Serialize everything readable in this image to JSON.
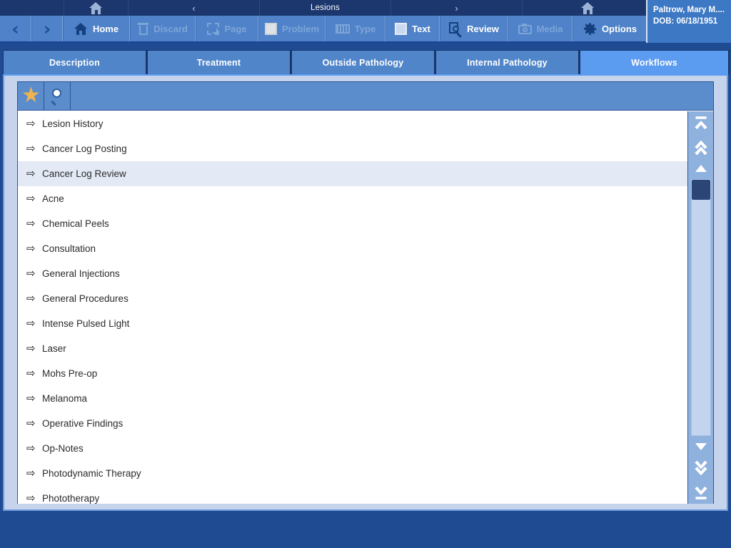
{
  "breadcrumb": {
    "home_icon": "home-icon",
    "prev_label": "‹",
    "title": "Lesions",
    "next_label": "›",
    "home_icon_2": "home-icon"
  },
  "toolbar": {
    "back_label": "‹",
    "forward_label": "›",
    "buttons": [
      {
        "label": "Home",
        "icon": "home-icon",
        "enabled": true
      },
      {
        "label": "Discard",
        "icon": "trash-icon",
        "enabled": false
      },
      {
        "label": "Page",
        "icon": "page-icon",
        "enabled": false
      },
      {
        "label": "Problem",
        "icon": "square-icon",
        "enabled": false
      },
      {
        "label": "Type",
        "icon": "keyboard-icon",
        "enabled": false
      },
      {
        "label": "Text",
        "icon": "square-icon",
        "enabled": true
      },
      {
        "label": "Review",
        "icon": "review-icon",
        "enabled": true
      },
      {
        "label": "Media",
        "icon": "camera-icon",
        "enabled": false
      },
      {
        "label": "Options",
        "icon": "gear-icon",
        "enabled": true
      }
    ],
    "options_caret": "chevron-down-icon"
  },
  "patient": {
    "name": "Paltrow, Mary M....",
    "dob_label": "DOB:",
    "dob_value": "06/18/1951"
  },
  "tabs": [
    {
      "label": "Description",
      "active": false
    },
    {
      "label": "Treatment",
      "active": false
    },
    {
      "label": "Outside Pathology",
      "active": false
    },
    {
      "label": "Internal Pathology",
      "active": false
    },
    {
      "label": "Workflows",
      "active": true
    }
  ],
  "list_toolbar": {
    "favorites_icon": "star-icon",
    "search_icon": "magnifier-icon"
  },
  "workflow_list": {
    "row_arrow_glyph": "⇨",
    "items": [
      {
        "label": "Lesion History",
        "selected": false
      },
      {
        "label": "Cancer Log Posting",
        "selected": false
      },
      {
        "label": "Cancer Log Review",
        "selected": true
      },
      {
        "label": "Acne",
        "selected": false
      },
      {
        "label": "Chemical Peels",
        "selected": false
      },
      {
        "label": "Consultation",
        "selected": false
      },
      {
        "label": "General Injections",
        "selected": false
      },
      {
        "label": "General Procedures",
        "selected": false
      },
      {
        "label": "Intense Pulsed Light",
        "selected": false
      },
      {
        "label": "Laser",
        "selected": false
      },
      {
        "label": "Mohs Pre-op",
        "selected": false
      },
      {
        "label": "Melanoma",
        "selected": false
      },
      {
        "label": "Operative Findings",
        "selected": false
      },
      {
        "label": "Op-Notes",
        "selected": false
      },
      {
        "label": "Photodynamic Therapy",
        "selected": false
      },
      {
        "label": "Phototherapy",
        "selected": false
      }
    ]
  },
  "scrollbar": {
    "top_icon": "scroll-to-top-icon",
    "page_up_icon": "page-up-icon",
    "line_up_icon": "scroll-up-icon",
    "line_down_icon": "scroll-down-icon",
    "page_down_icon": "page-down-icon",
    "bottom_icon": "scroll-to-bottom-icon",
    "thumb": "scrollbar-thumb"
  },
  "colors": {
    "desktop": "#1f4b92",
    "toolbar": "#4f82c8",
    "breadcrumb": "#1b376e",
    "tab_inactive": "#5085c9",
    "tab_active": "#5b9bf0",
    "panel": "#c5d3ec",
    "row_selected": "#e3eaf5",
    "star": "#efb350",
    "scrollbar_track": "#c3d4ef",
    "scrollbar_thumb": "#2c4577"
  }
}
